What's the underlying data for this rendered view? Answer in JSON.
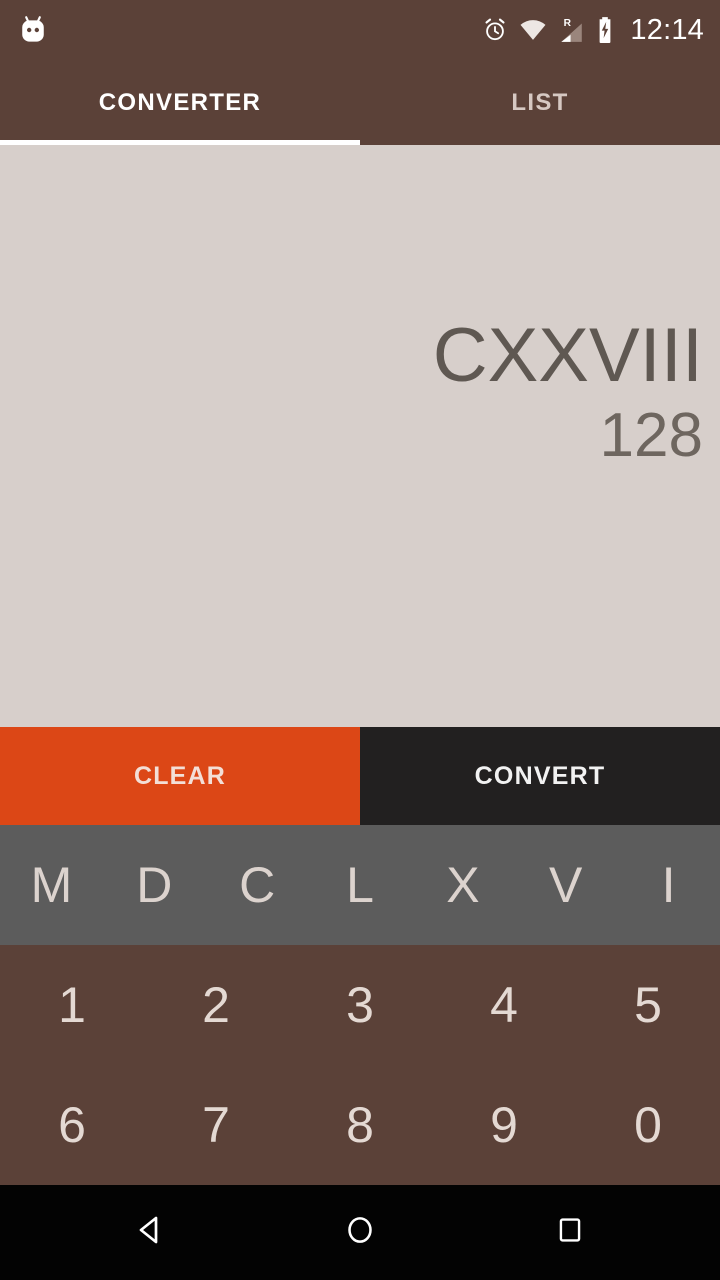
{
  "statusbar": {
    "icons": [
      "android-head-icon",
      "alarm-icon",
      "wifi-icon",
      "roaming-signal-icon",
      "battery-charging-icon"
    ],
    "roaming_label": "R",
    "time": "12:14"
  },
  "tabs": [
    {
      "label": "CONVERTER",
      "active": true
    },
    {
      "label": "LIST",
      "active": false
    }
  ],
  "display": {
    "roman": "CXXVIII",
    "arabic": "128"
  },
  "actions": {
    "clear_label": "CLEAR",
    "convert_label": "CONVERT"
  },
  "roman_keys": [
    "M",
    "D",
    "C",
    "L",
    "X",
    "V",
    "I"
  ],
  "number_keys": [
    [
      "1",
      "2",
      "3",
      "4",
      "5"
    ],
    [
      "6",
      "7",
      "8",
      "9",
      "0"
    ]
  ],
  "navbar": {
    "back": "back-icon",
    "home": "home-icon",
    "recents": "recents-icon"
  },
  "colors": {
    "brand_brown": "#5B4138",
    "display_bg": "#D7CFCB",
    "accent_orange": "#DC4716",
    "convert_dark": "#222020",
    "roman_row_gray": "#5C5C5C",
    "nav_black": "#030303"
  }
}
